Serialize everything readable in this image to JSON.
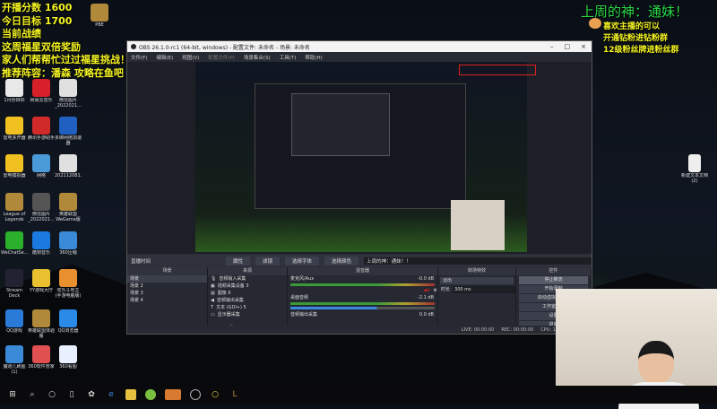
{
  "overlay_left": [
    "开播分数 1600",
    "今日目标 1700",
    "当前战绩",
    "这周福星双倍奖励",
    "家人们帮帮忙过过福星挑战！",
    "推荐阵容：潘森 攻略在鱼吧"
  ],
  "overlay_right": {
    "title": "上周的神：通妹！",
    "lines": [
      "喜欢主播的可以",
      "开通钻粉进钻粉群",
      "12级粉丝牌进粉丝群"
    ]
  },
  "desktop_icons": [
    {
      "label": "1月份目标",
      "color": "#e8e8e8"
    },
    {
      "label": "网易云音乐",
      "color": "#d8202a"
    },
    {
      "label": "微信图片_2022021...",
      "color": "#e0e0e0"
    },
    {
      "label": "雷电多开器",
      "color": "#f0c020"
    },
    {
      "label": "腾讯手游助手",
      "color": "#d02a2a"
    },
    {
      "label": "多御网络加速器",
      "color": "#2060c0"
    },
    {
      "label": "雷电模拟器",
      "color": "#f0c020"
    },
    {
      "label": "网络",
      "color": "#4a9ad8"
    },
    {
      "label": "202112081...",
      "color": "#e0e0e0"
    },
    {
      "label": "League of Legends",
      "color": "#b08a3a"
    },
    {
      "label": "微信图片_2022021...",
      "color": "#555"
    },
    {
      "label": "英雄联盟WeGame版",
      "color": "#b08a3a"
    },
    {
      "label": "WeChatSe...",
      "color": "#2bb02b"
    },
    {
      "label": "酷狗音乐",
      "color": "#1a7ae0"
    },
    {
      "label": "360压缩",
      "color": "#3a8ad8"
    },
    {
      "label": "Stream Deck",
      "color": "#223"
    },
    {
      "label": "YY游戏大厅",
      "color": "#e8c030"
    },
    {
      "label": "欢乐斗地主(手游电脑版)",
      "color": "#e89030"
    },
    {
      "label": "QQ游戏",
      "color": "#2a7ad8"
    },
    {
      "label": "英雄联盟体验服",
      "color": "#b08a3a"
    },
    {
      "label": "QQ浏览器",
      "color": "#2a8ae8"
    },
    {
      "label": "魔道儿刷图(1)",
      "color": "#3a8ad8"
    },
    {
      "label": "360软件管家",
      "color": "#e05050"
    },
    {
      "label": "360看图",
      "color": "#e8f0ff"
    }
  ],
  "top_icon": "PBE",
  "right_icon": "新建文本文档 (2)",
  "obs": {
    "title": "OBS 26.1.0-rc1 (64-bit, windows) - 配置文件: 未命名 - 场景: 未命名",
    "menu": [
      "文件(F)",
      "编辑(E)",
      "视图(V)",
      "配置文件(P)",
      "场景集合(S)",
      "工具(T)",
      "帮助(H)"
    ],
    "source_bar": {
      "name": "直播时间",
      "properties": "属性",
      "filters": "滤镜",
      "font": "选择字体",
      "color": "选择颜色",
      "text": "上周的神：通妹！！"
    },
    "scenes": {
      "header": "场景",
      "items": [
        "场景",
        "场景 2",
        "场景 3",
        "场景 4"
      ]
    },
    "sources": {
      "header": "来源",
      "items": [
        "音频输入采集",
        "视频采集设备 3",
        "图像 6",
        "音频输出采集",
        "文本 (GDI+) 5",
        "显示器采集"
      ]
    },
    "mixer": {
      "header": "混音器",
      "channels": [
        {
          "name": "麦克风/Aux",
          "db": "-0.0 dB"
        },
        {
          "name": "桌面音频",
          "db": "-2.1 dB"
        },
        {
          "name": "音频输出采集",
          "db": "0.0 dB"
        }
      ]
    },
    "transitions": {
      "header": "转场特效",
      "value": "淡出",
      "duration_label": "时长",
      "duration": "300 ms"
    },
    "controls": {
      "header": "控件",
      "buttons": [
        "停止推流",
        "开始录制",
        "启动虚拟摄像机",
        "工作室模式",
        "设置",
        "退出"
      ]
    },
    "status": {
      "live": "LIVE: 00:00:00",
      "rec": "REC: 00:00:00",
      "cpu": "CPU: 1.3%, 30.00 fps"
    }
  }
}
